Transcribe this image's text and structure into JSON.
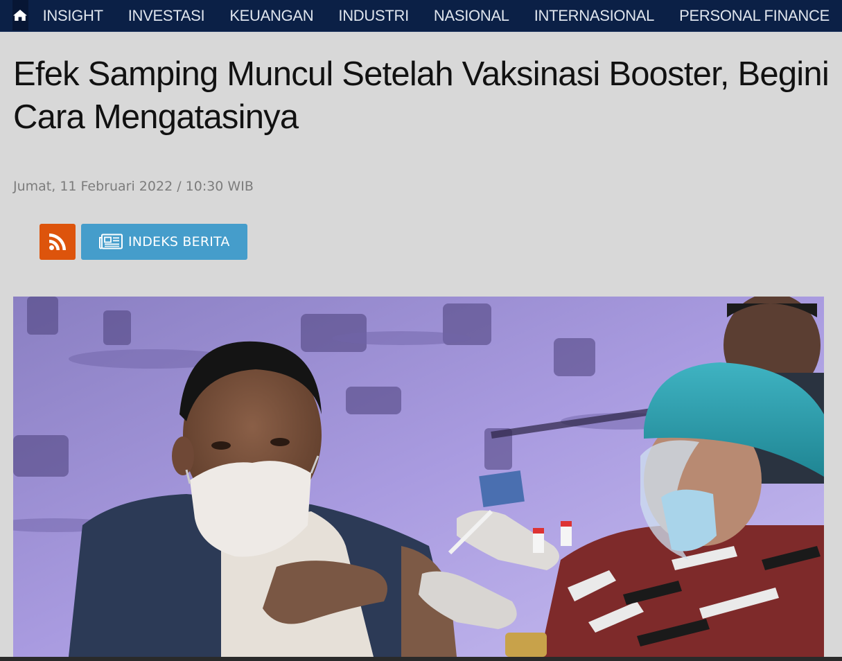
{
  "nav": {
    "home_icon": "home-icon",
    "items": [
      "INSIGHT",
      "INVESTASI",
      "KEUANGAN",
      "INDUSTRI",
      "NASIONAL",
      "INTERNASIONAL",
      "PERSONAL FINANCE"
    ]
  },
  "article": {
    "title": "Efek Samping Muncul Setelah Vaksinasi Booster, Begini Cara Mengatasinya",
    "date": "Jumat, 11 Februari 2022 / 10:30 WIB"
  },
  "actions": {
    "rss_icon": "rss-icon",
    "index_icon": "newspaper-icon",
    "index_label": "INDEKS BERITA"
  },
  "colors": {
    "nav_bg": "#0b2046",
    "rss": "#dd540c",
    "index": "#459dcb",
    "page_bg": "#d8d8d8"
  }
}
